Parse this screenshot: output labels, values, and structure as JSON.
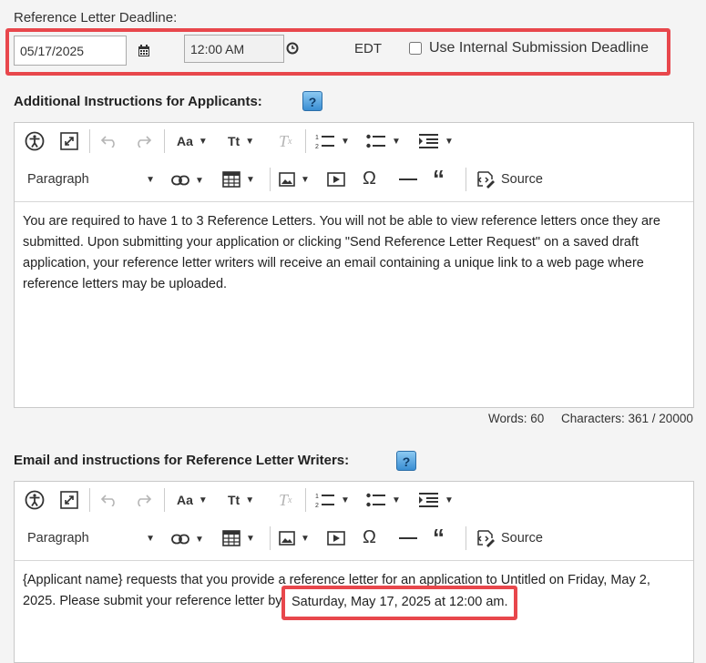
{
  "deadline": {
    "label": "Reference Letter Deadline:",
    "date_value": "05/17/2025",
    "time_value": "12:00 AM",
    "timezone": "EDT",
    "internal_checkbox_label": "Use Internal Submission Deadline",
    "internal_checked": false
  },
  "applicants_section": {
    "title": "Additional Instructions for Applicants:",
    "help_label": "?",
    "toolbar": {
      "heading_select": "Paragraph",
      "font_size_label": "Aa",
      "text_transform_label": "Tt",
      "source_label": "Source"
    },
    "content": "You are required to have 1 to 3 Reference Letters. You will not be able to view reference letters once they are submitted. Upon submitting your application or clicking \"Send Reference Letter Request\" on a saved draft application, your reference letter writers will receive an email containing a unique link to a web page where reference letters may be uploaded.",
    "words": "Words: 60",
    "characters": "Characters: 361 / 20000"
  },
  "writers_section": {
    "title": "Email and instructions for Reference Letter Writers:",
    "help_label": "?",
    "toolbar": {
      "heading_select": "Paragraph",
      "font_size_label": "Aa",
      "text_transform_label": "Tt",
      "source_label": "Source"
    },
    "content_line1": "{Applicant name} requests that you provide a reference letter for an application to Untitled on Friday, May 2,",
    "content_line2_prefix": "2025. Please submit your reference letter by",
    "content_highlight": "Saturday, May 17, 2025 at 12:00 am."
  },
  "colors": {
    "highlight": "#e8474c",
    "help_button": "#3a8ed3"
  }
}
